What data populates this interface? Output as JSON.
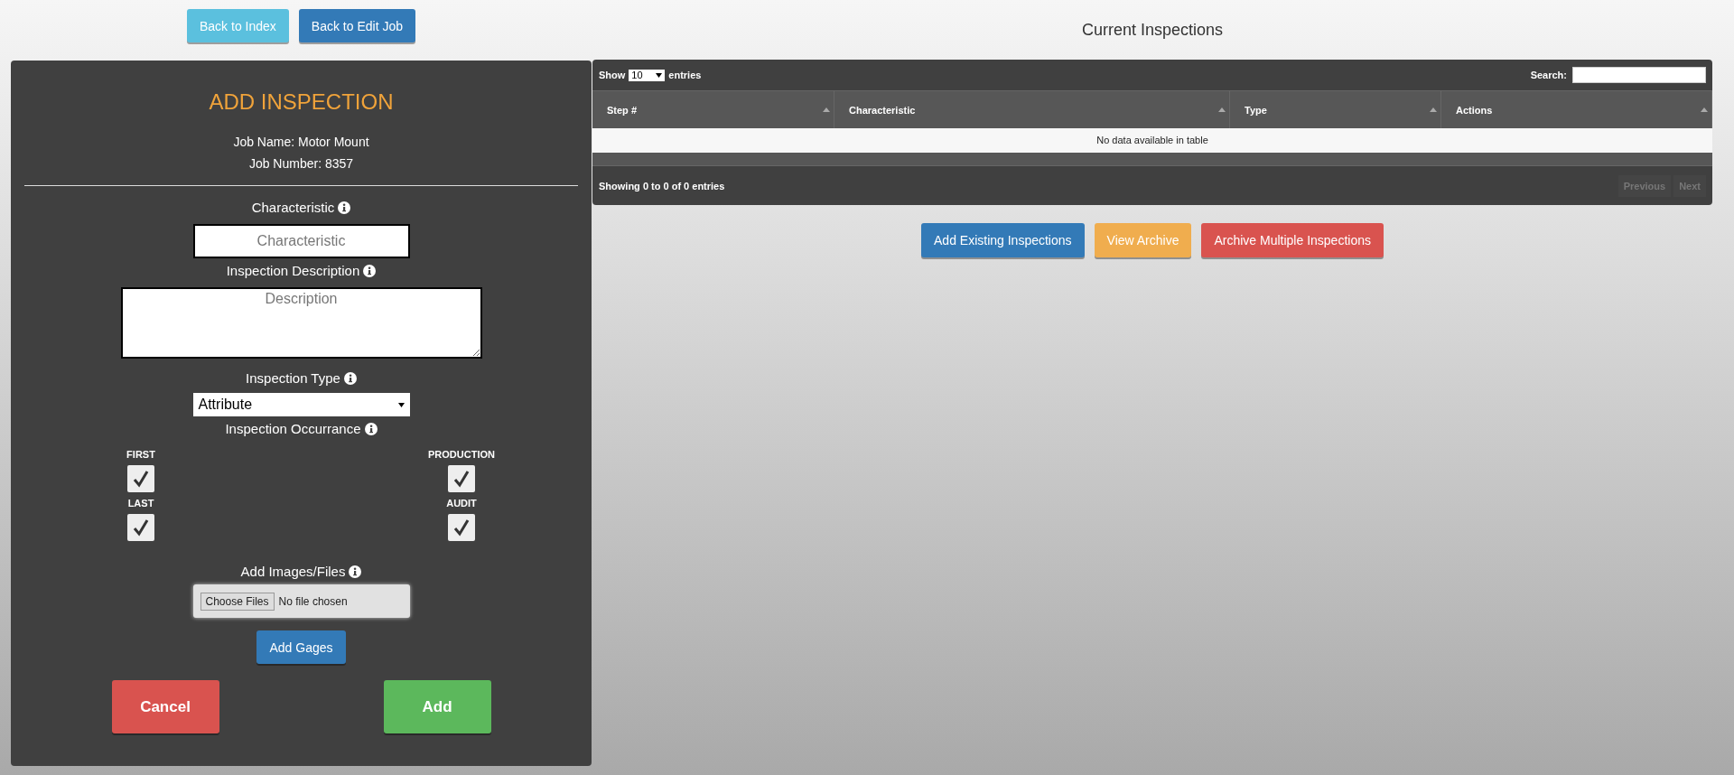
{
  "nav_buttons": [
    {
      "label": "Back to Index",
      "kind": "info"
    },
    {
      "label": "Back to Edit Job",
      "kind": "primary"
    }
  ],
  "form": {
    "title": "ADD INSPECTION",
    "job_name": "Job Name: Motor Mount",
    "job_number": "Job Number: 8357",
    "characteristic": {
      "label": "Characteristic",
      "placeholder": "Characteristic"
    },
    "description": {
      "label": "Inspection Description",
      "placeholder": "Description"
    },
    "type": {
      "label": "Inspection Type",
      "value": "Attribute"
    },
    "occurrence": {
      "label": "Inspection Occurrance",
      "options": [
        {
          "label": "FIRST",
          "checked": true
        },
        {
          "label": "PRODUCTION",
          "checked": true
        },
        {
          "label": "LAST",
          "checked": true
        },
        {
          "label": "AUDIT",
          "checked": true
        }
      ]
    },
    "files": {
      "label": "Add Images/Files",
      "button": "Choose Files",
      "status": "No file chosen"
    },
    "gages_button": "Add Gages",
    "actions": [
      {
        "label": "Cancel",
        "kind": "danger"
      },
      {
        "label": "Add",
        "kind": "success"
      }
    ]
  },
  "inspections": {
    "title": "Current Inspections",
    "length": {
      "prefix": "Show",
      "value": "10",
      "suffix": "entries"
    },
    "search": {
      "label": "Search:"
    },
    "table": {
      "columns": [
        "Step #",
        "Characteristic",
        "Type",
        "Actions"
      ],
      "empty": "No data available in table"
    },
    "info": "Showing 0 to 0 of 0 entries",
    "pagination": [
      {
        "label": "Previous",
        "disabled": true
      },
      {
        "label": "Next",
        "disabled": true
      }
    ],
    "buttons": [
      {
        "label": "Add Existing Inspections",
        "kind": "primary"
      },
      {
        "label": "View Archive",
        "kind": "warning"
      },
      {
        "label": "Archive Multiple Inspections",
        "kind": "danger"
      }
    ]
  }
}
